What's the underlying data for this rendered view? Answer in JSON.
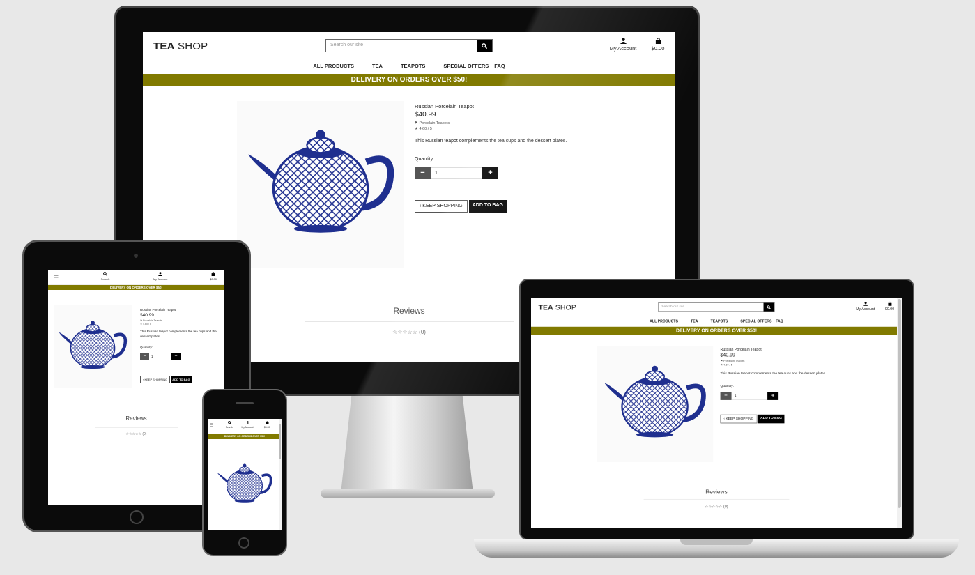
{
  "shop": {
    "logo_bold": "TEA",
    "logo_rest": "SHOP",
    "search_placeholder": "Search our site",
    "account_label": "My Account",
    "bag_total": "$0.00",
    "nav": [
      "ALL PRODUCTS",
      "TEA",
      "TEAPOTS",
      "SPECIAL OFFERS",
      "FAQ"
    ],
    "banner": "DELIVERY ON ORDERS OVER $50!",
    "product": {
      "name": "Russian Porcelain Teapot",
      "price": "$40.99",
      "category": "Porcelain Teapots",
      "rating": "4.60 / 5",
      "description": "This Russian teapot complements the tea cups and the dessert plates.",
      "quantity_label": "Quantity:",
      "quantity": "1"
    },
    "keep_shopping": "KEEP SHOPPING",
    "add_to_bag": "ADD TO BAG",
    "reviews_title": "Reviews",
    "reviews_count": "(0)"
  },
  "mobile": {
    "search_label": "Search",
    "account_label": "My Account",
    "bag_total": "$0.00"
  },
  "colors": {
    "banner": "#817a00",
    "teapot_blue": "#1f2f8f"
  },
  "icons": [
    "search-icon",
    "user-icon",
    "bag-icon",
    "tag-icon",
    "star-icon",
    "chevron-left-icon",
    "minus-icon",
    "plus-icon",
    "hamburger-icon"
  ]
}
